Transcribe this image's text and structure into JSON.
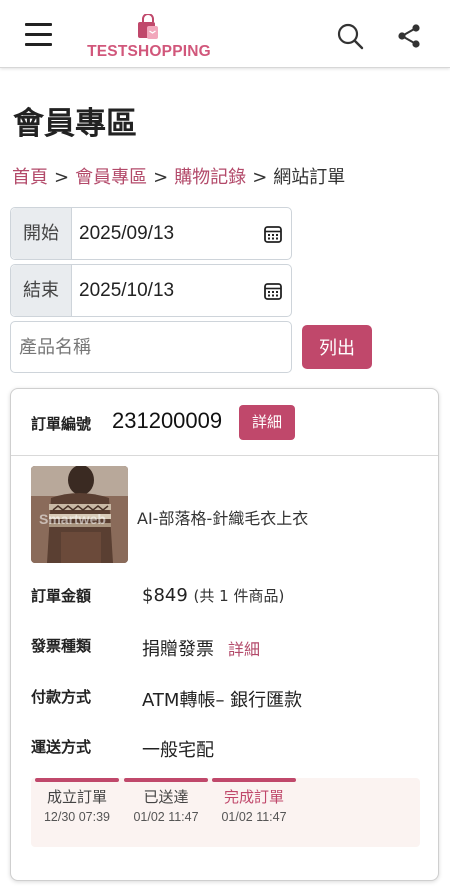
{
  "header": {
    "brand": "TESTSHOPPING"
  },
  "page_title": "會員專區",
  "breadcrumb": {
    "items": [
      "首頁",
      "會員專區",
      "購物記錄"
    ],
    "separator": ">",
    "current": "網站訂單"
  },
  "filters": {
    "start_label": "開始",
    "start_value": "2025/09/13",
    "end_label": "結束",
    "end_value": "2025/10/13",
    "product_placeholder": "產品名稱",
    "list_button": "列出"
  },
  "order": {
    "number_label": "訂單編號",
    "number": "231200009",
    "detail_button": "詳細",
    "product_name": "AI-部落格-針織毛衣上衣",
    "amount_label": "訂單金額",
    "amount_value": "$849",
    "amount_note": "(共 1 件商品)",
    "invoice_label": "發票種類",
    "invoice_value": "捐贈發票",
    "invoice_detail": "詳細",
    "payment_label": "付款方式",
    "payment_value": "ATM轉帳– 銀行匯款",
    "shipping_label": "運送方式",
    "shipping_value": "一般宅配",
    "statuses": [
      {
        "name": "成立訂單",
        "time": "12/30 07:39"
      },
      {
        "name": "已送達",
        "time": "01/02 11:47"
      },
      {
        "name": "完成訂單",
        "time": "01/02 11:47"
      }
    ]
  },
  "colors": {
    "accent": "#c0486b",
    "brand": "#d1577b",
    "link": "#b34a6a",
    "status_bg": "#fbf3f1"
  },
  "icons": [
    "menu-icon",
    "shopping-bag-icon",
    "search-icon",
    "share-icon",
    "calendar-icon"
  ]
}
